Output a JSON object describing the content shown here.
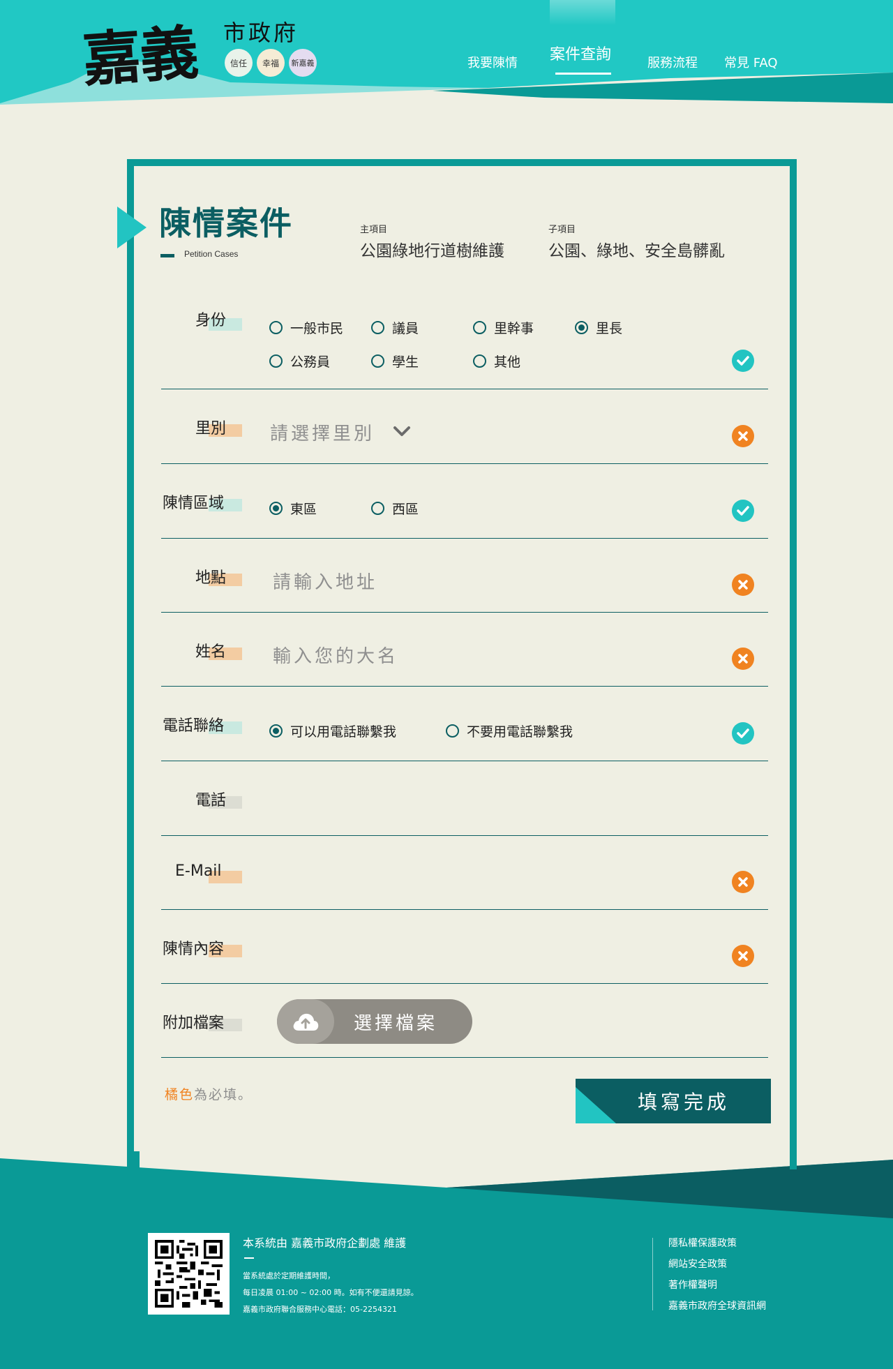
{
  "header": {
    "logo_main": "嘉義",
    "logo_sub": "市政府",
    "badges": [
      "信任",
      "幸福",
      "新嘉義"
    ],
    "nav": [
      "我要陳情",
      "案件查詢",
      "服務流程",
      "常見 FAQ"
    ],
    "active_nav": "案件查詢"
  },
  "page": {
    "title": "陳情案件",
    "subtitle_en": "Petition Cases",
    "main_category_label": "主項目",
    "main_category_value": "公園綠地行道樹維護",
    "sub_category_label": "子項目",
    "sub_category_value": "公園、綠地、安全島髒亂"
  },
  "form": {
    "identity": {
      "label": "身份",
      "options": [
        "一般市民",
        "議員",
        "里幹事",
        "里長",
        "公務員",
        "學生",
        "其他"
      ],
      "selected": "里長",
      "status": "ok"
    },
    "village": {
      "label": "里別",
      "placeholder": "請選擇里別",
      "status": "error"
    },
    "area": {
      "label": "陳情區域",
      "options": [
        "東區",
        "西區"
      ],
      "selected": "東區",
      "status": "ok"
    },
    "location": {
      "label": "地點",
      "placeholder": "請輸入地址",
      "status": "error"
    },
    "name": {
      "label": "姓名",
      "placeholder": "輸入您的大名",
      "status": "error"
    },
    "contact": {
      "label": "電話聯絡",
      "options": [
        "可以用電話聯繫我",
        "不要用電話聯繫我"
      ],
      "selected": "可以用電話聯繫我",
      "status": "ok"
    },
    "phone": {
      "label": "電話",
      "value": ""
    },
    "email": {
      "label": "E-Mail",
      "value": "",
      "status": "error"
    },
    "content": {
      "label": "陳情內容",
      "value": "",
      "status": "error"
    },
    "attachment": {
      "label": "附加檔案",
      "button": "選擇檔案"
    },
    "required_note_em": "橘色",
    "required_note_rest": "為必填。",
    "submit": "填寫完成"
  },
  "footer": {
    "maintainer": "本系統由 嘉義市政府企劃處 維護",
    "note_1": "當系統處於定期維護時間，",
    "note_2": "每日凌晨 01:00 ~ 02:00 時。如有不便還請見諒。",
    "note_3": "嘉義市政府聯合服務中心電話：05-2254321",
    "links": [
      "隱私權保護政策",
      "網站安全政策",
      "著作權聲明",
      "嘉義市政府全球資訊網"
    ]
  },
  "colors": {
    "teal": "#22c4c2",
    "dark_teal": "#0b5e62",
    "border_teal": "#0a9a96",
    "error_orange": "#f08321",
    "background": "#efefe3"
  },
  "icons": {
    "ok": "check-circle-icon",
    "error": "x-circle-icon",
    "dropdown": "chevron-down-icon",
    "upload": "cloud-upload-icon"
  }
}
